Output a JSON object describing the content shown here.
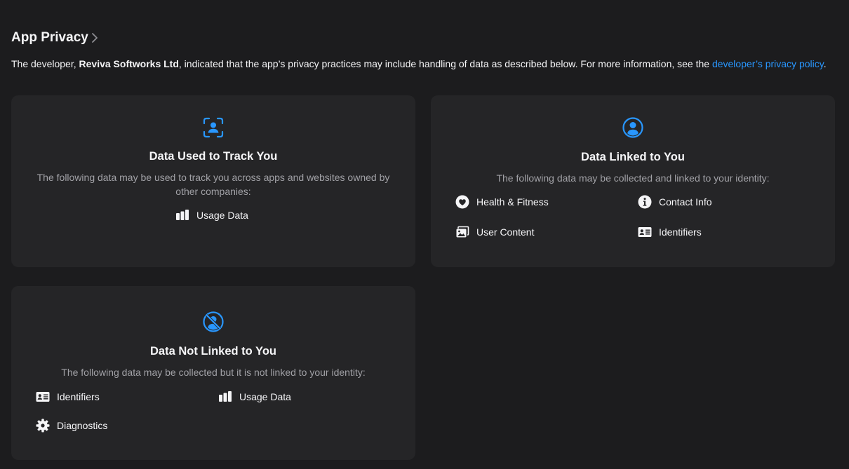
{
  "section": {
    "title": "App Privacy",
    "intro_before": "The developer, ",
    "developer_name": "Reviva Softworks Ltd",
    "intro_after": ", indicated that the app’s privacy practices may include handling of data as described below. For more information, see the ",
    "policy_link": "developer’s privacy policy",
    "intro_end": "."
  },
  "cards": {
    "track": {
      "icon": "person-viewfinder-icon",
      "title": "Data Used to Track You",
      "description": "The following data may be used to track you across apps and websites owned by other companies:",
      "items": [
        {
          "label": "Usage Data",
          "icon": "bar-chart-icon"
        }
      ]
    },
    "linked": {
      "icon": "person-circle-icon",
      "title": "Data Linked to You",
      "description": "The following data may be collected and linked to your identity:",
      "items": [
        {
          "label": "Health & Fitness",
          "icon": "heart-icon"
        },
        {
          "label": "Contact Info",
          "icon": "info-icon"
        },
        {
          "label": "User Content",
          "icon": "photos-icon"
        },
        {
          "label": "Identifiers",
          "icon": "id-card-icon"
        }
      ]
    },
    "not_linked": {
      "icon": "person-slash-icon",
      "title": "Data Not Linked to You",
      "description": "The following data may be collected but it is not linked to your identity:",
      "items": [
        {
          "label": "Identifiers",
          "icon": "id-card-icon"
        },
        {
          "label": "Usage Data",
          "icon": "bar-chart-icon"
        },
        {
          "label": "Diagnostics",
          "icon": "gear-icon"
        }
      ]
    }
  },
  "colors": {
    "accent": "#2997ff",
    "background": "#1c1c1e",
    "card": "#252527",
    "secondary_text": "#a1a1a6"
  }
}
